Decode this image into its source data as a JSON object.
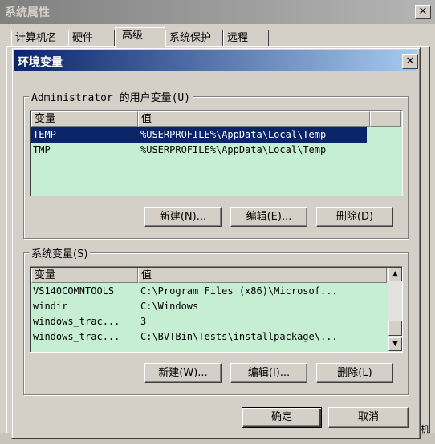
{
  "outer_window": {
    "title": "系统属性",
    "tabs": [
      {
        "label": "计算机名"
      },
      {
        "label": "硬件"
      },
      {
        "label": "高级"
      },
      {
        "label": "系统保护"
      },
      {
        "label": "远程"
      }
    ],
    "bottom_fragment": "机"
  },
  "dialog": {
    "title": "环境变量",
    "close_glyph": "✕",
    "user_vars": {
      "group_title": "Administrator 的用户变量(U)",
      "columns": [
        "变量",
        "值"
      ],
      "rows": [
        {
          "name": "TEMP",
          "value": "%USERPROFILE%\\AppData\\Local\\Temp",
          "selected": true
        },
        {
          "name": "TMP",
          "value": "%USERPROFILE%\\AppData\\Local\\Temp",
          "selected": false
        }
      ],
      "buttons": {
        "new": "新建(N)...",
        "edit": "编辑(E)...",
        "delete": "删除(D)"
      }
    },
    "system_vars": {
      "group_title": "系统变量(S)",
      "columns": [
        "变量",
        "值"
      ],
      "rows": [
        {
          "name": "VS140COMNTOOLS",
          "value": "C:\\Program Files (x86)\\Microsof..."
        },
        {
          "name": "windir",
          "value": "C:\\Windows"
        },
        {
          "name": "windows_trac...",
          "value": "3"
        },
        {
          "name": "windows_trac...",
          "value": "C:\\BVTBin\\Tests\\installpackage\\..."
        }
      ],
      "buttons": {
        "new": "新建(W)...",
        "edit": "编辑(I)...",
        "delete": "删除(L)"
      }
    },
    "ok_label": "确定",
    "cancel_label": "取消"
  },
  "colors": {
    "list_background": "#c6eed2",
    "selection": "#0a246a",
    "active_title_start": "#0a246a",
    "active_title_end": "#a6caf0",
    "inactive_title": "#808080"
  }
}
